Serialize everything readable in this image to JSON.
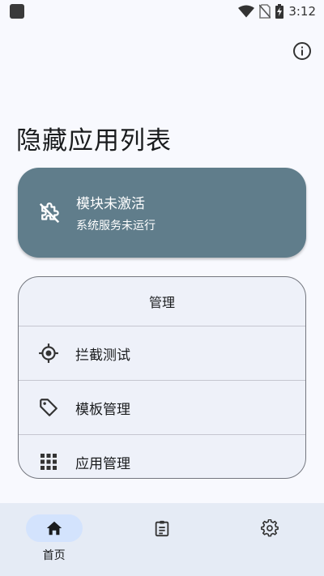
{
  "status_bar": {
    "time": "3:12",
    "icons": [
      "notification-square-icon",
      "wifi-icon",
      "no-sim-icon",
      "battery-charging-icon"
    ]
  },
  "header": {
    "info_icon": "info-circle-icon"
  },
  "page": {
    "title": "隐藏应用列表"
  },
  "module_status": {
    "title": "模块未激活",
    "subtitle": "系统服务未运行",
    "icon": "extension-off-icon",
    "color": "#607d8b"
  },
  "manage": {
    "header": "管理",
    "items": [
      {
        "label": "拦截测试",
        "icon": "gps-target-icon"
      },
      {
        "label": "模板管理",
        "icon": "tag-icon"
      },
      {
        "label": "应用管理",
        "icon": "apps-grid-icon"
      }
    ]
  },
  "bottom_nav": {
    "items": [
      {
        "label": "首页",
        "icon": "home-icon",
        "active": true
      },
      {
        "label": "",
        "icon": "clipboard-list-icon",
        "active": false
      },
      {
        "label": "",
        "icon": "gear-icon",
        "active": false
      }
    ]
  }
}
